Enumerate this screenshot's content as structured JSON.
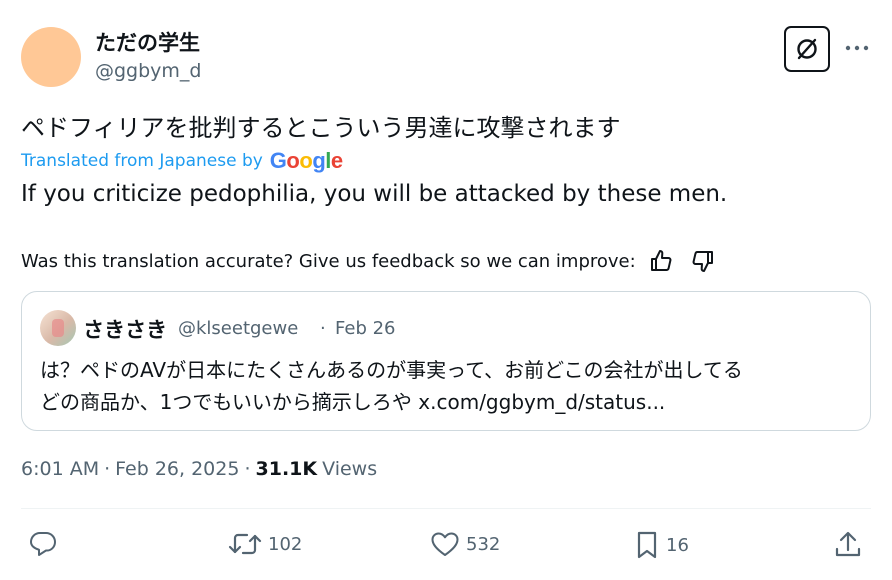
{
  "author": {
    "display_name": "ただの学生",
    "handle": "@ggbym_d",
    "avatar_color": "#ffc896"
  },
  "tweet": {
    "text": "ペドフィリアを批判するとこういう男達に攻撃されます",
    "translated_label": "Translated from Japanese by",
    "translator_logo": "Google",
    "translation": "If you criticize pedophilia, you will be attacked by these men.",
    "feedback_prompt": "Was this translation accurate? Give us feedback so we can improve:"
  },
  "quote": {
    "display_name": "さきさき",
    "handle": "@klseetgewe",
    "separator": "·",
    "date": "Feb 26",
    "line1": "は？ペドのAVが日本にたくさんあるのが事実って、お前どこの会社が出してる",
    "line2": "どの商品か、1つでもいいから摘示しろや x.com/ggbym_d/status..."
  },
  "meta": {
    "time": "6:01 AM",
    "date": "Feb 26, 2025",
    "views_count": "31.1K",
    "views_label": "Views",
    "separator": "·"
  },
  "actions": {
    "reply_count": "",
    "retweet_count": "102",
    "like_count": "532",
    "bookmark_count": "16"
  },
  "icons": [
    "grok-icon",
    "more-icon",
    "thumbs-up-icon",
    "thumbs-down-icon",
    "reply-icon",
    "retweet-icon",
    "like-icon",
    "bookmark-icon",
    "share-icon"
  ],
  "colors": {
    "link": "#1d9bf0",
    "secondary_text": "#536471",
    "primary_text": "#0f1419",
    "border": "#cfd9de"
  }
}
